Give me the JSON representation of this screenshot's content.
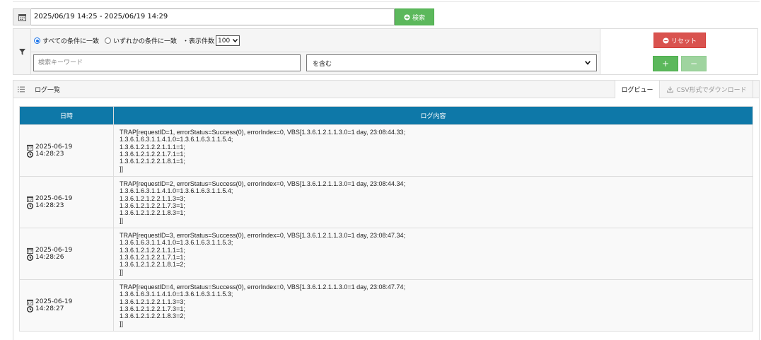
{
  "date_range": {
    "value": "2025/06/19 14:25 - 2025/06/19 14:29",
    "search_label": "検索"
  },
  "filter": {
    "match_all_label": "すべての条件に一致",
    "match_any_label": "いずれかの条件に一致",
    "count_label": "・表示件数",
    "count_value": "100",
    "keyword_placeholder": "検索キーワード",
    "condition_value": "を含む",
    "reset_label": "リセット",
    "add_label": "+",
    "remove_label": "−"
  },
  "log_panel": {
    "title": "ログ一覧",
    "tab_view": "ログビュー",
    "tab_csv": "CSV形式でダウンロード"
  },
  "table": {
    "headers": {
      "date": "日時",
      "content": "ログ内容"
    },
    "rows": [
      {
        "date": "2025-06-19",
        "time": "14:28:23",
        "lines": [
          "TRAP[requestID=1, errorStatus=Success(0), errorIndex=0, VBS[1.3.6.1.2.1.1.3.0=1 day, 23:08:44.33;",
          "1.3.6.1.6.3.1.1.4.1.0=1.3.6.1.6.3.1.1.5.4;",
          "1.3.6.1.2.1.2.2.1.1.1=1;",
          "1.3.6.1.2.1.2.2.1.7.1=1;",
          "1.3.6.1.2.1.2.2.1.8.1=1;",
          "]]"
        ]
      },
      {
        "date": "2025-06-19",
        "time": "14:28:23",
        "lines": [
          "TRAP[requestID=2, errorStatus=Success(0), errorIndex=0, VBS[1.3.6.1.2.1.1.3.0=1 day, 23:08:44.34;",
          "1.3.6.1.6.3.1.1.4.1.0=1.3.6.1.6.3.1.1.5.4;",
          "1.3.6.1.2.1.2.2.1.1.3=3;",
          "1.3.6.1.2.1.2.2.1.7.3=1;",
          "1.3.6.1.2.1.2.2.1.8.3=1;",
          "]]"
        ]
      },
      {
        "date": "2025-06-19",
        "time": "14:28:26",
        "lines": [
          "TRAP[requestID=3, errorStatus=Success(0), errorIndex=0, VBS[1.3.6.1.2.1.1.3.0=1 day, 23:08:47.34;",
          "1.3.6.1.6.3.1.1.4.1.0=1.3.6.1.6.3.1.1.5.3;",
          "1.3.6.1.2.1.2.2.1.1.1=1;",
          "1.3.6.1.2.1.2.2.1.7.1=1;",
          "1.3.6.1.2.1.2.2.1.8.1=2;",
          "]]"
        ]
      },
      {
        "date": "2025-06-19",
        "time": "14:28:27",
        "lines": [
          "TRAP[requestID=4, errorStatus=Success(0), errorIndex=0, VBS[1.3.6.1.2.1.1.3.0=1 day, 23:08:47.74;",
          "1.3.6.1.6.3.1.1.4.1.0=1.3.6.1.6.3.1.1.5.3;",
          "1.3.6.1.2.1.2.2.1.1.3=3;",
          "1.3.6.1.2.1.2.2.1.7.3=1;",
          "1.3.6.1.2.1.2.2.1.8.3=2;",
          "]]"
        ]
      }
    ]
  },
  "colors": {
    "header_blue": "#0e78a8",
    "success_green": "#5cb85c",
    "danger_red": "#d9534f"
  },
  "icons": {
    "date_picker": "calendar-icon",
    "search": "plus-circle-icon",
    "filter": "filter-icon",
    "reset": "minus-circle-icon",
    "list": "list-icon",
    "download": "download-icon",
    "row_date": "calendar-icon",
    "row_time": "clock-icon"
  }
}
